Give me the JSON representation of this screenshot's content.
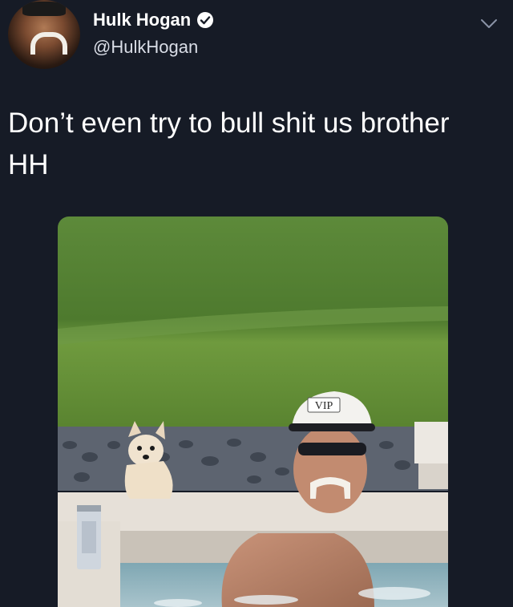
{
  "tweet": {
    "display_name": "Hulk Hogan",
    "handle": "@HulkHogan",
    "text_line1": "Don’t even try to bull shit us brother",
    "text_line2": "HH",
    "verified_icon": "verified-badge-icon",
    "menu_icon": "chevron-down-icon"
  },
  "photo": {
    "cap_text": "VIP"
  },
  "colors": {
    "background": "#161b26",
    "text": "#ffffff",
    "handle": "#d9dde6"
  }
}
